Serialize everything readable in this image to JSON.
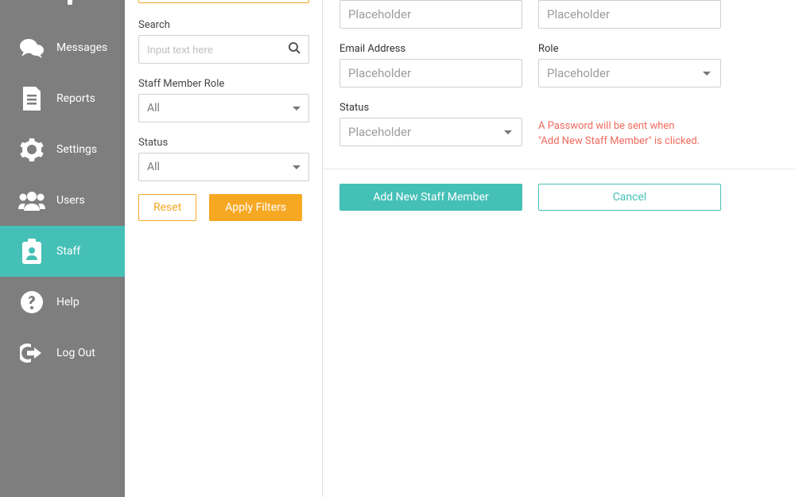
{
  "sidebar": {
    "items": [
      {
        "label": "Messages"
      },
      {
        "label": "Reports"
      },
      {
        "label": "Settings"
      },
      {
        "label": "Users"
      },
      {
        "label": "Staff"
      },
      {
        "label": "Help"
      },
      {
        "label": "Log Out"
      }
    ]
  },
  "filters": {
    "search_label": "Search",
    "search_placeholder": "Input text here",
    "role_label": "Staff Member Role",
    "role_value": "All",
    "status_label": "Status",
    "status_value": "All",
    "reset_label": "Reset",
    "apply_label": "Apply Filters"
  },
  "form": {
    "row1": {
      "left_placeholder": "Placeholder",
      "right_placeholder": "Placeholder"
    },
    "email_label": "Email Address",
    "email_placeholder": "Placeholder",
    "role_label": "Role",
    "role_placeholder": "Placeholder",
    "status_label": "Status",
    "status_placeholder": "Placeholder",
    "password_note_line1": "A Password will be sent when",
    "password_note_line2": "\"Add New Staff Member\" is clicked.",
    "add_label": "Add New Staff Member",
    "cancel_label": "Cancel"
  },
  "colors": {
    "teal": "#45c0b7",
    "orange": "#f7a823",
    "sidebar": "#7e7e7e",
    "error": "#ef6a5d"
  }
}
